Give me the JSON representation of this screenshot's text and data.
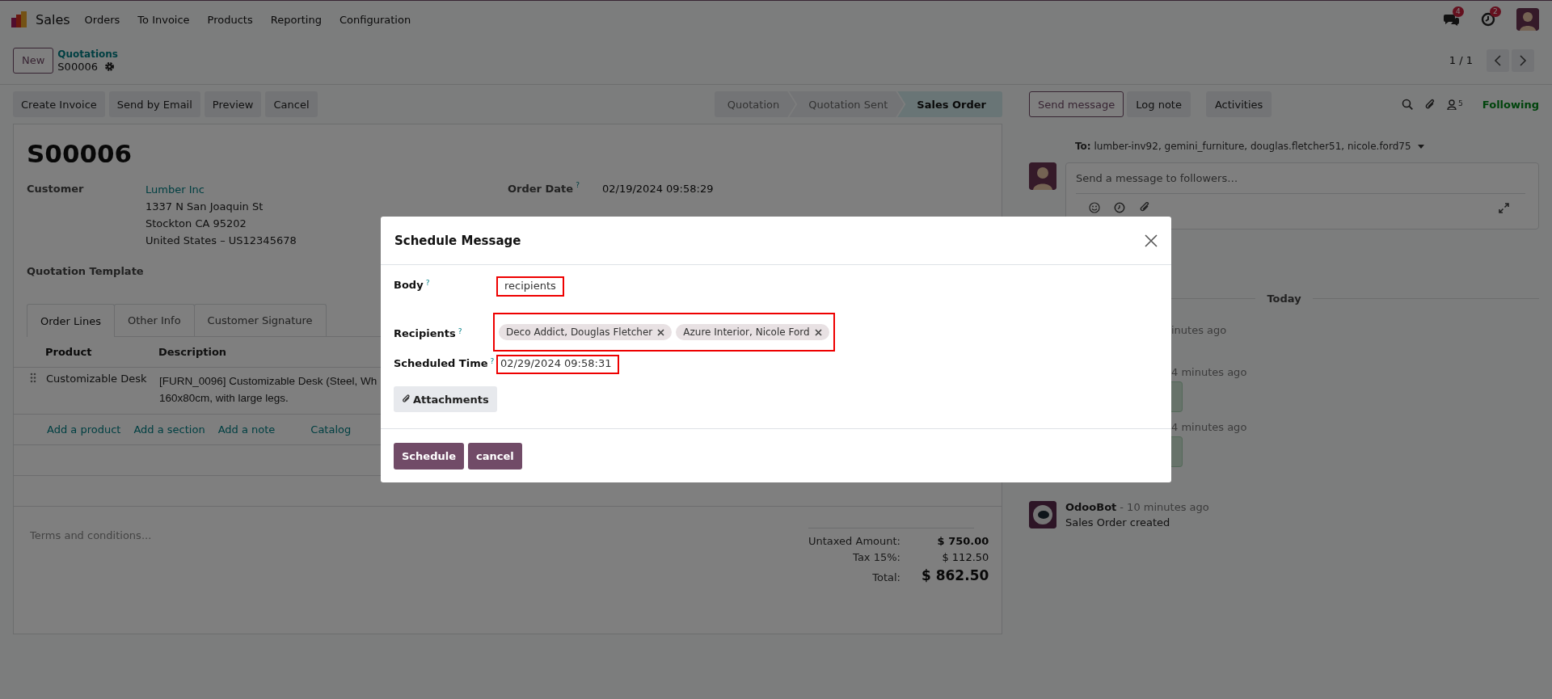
{
  "navbar": {
    "app": "Sales",
    "menu": [
      "Orders",
      "To Invoice",
      "Products",
      "Reporting",
      "Configuration"
    ],
    "messages_count": "4",
    "activities_count": "2"
  },
  "control_panel": {
    "new_button": "New",
    "breadcrumb_parent": "Quotations",
    "breadcrumb_current": "S00006",
    "pager": "1 / 1"
  },
  "actions": [
    "Create Invoice",
    "Send by Email",
    "Preview",
    "Cancel"
  ],
  "stages": [
    {
      "label": "Quotation",
      "selected": false
    },
    {
      "label": "Quotation Sent",
      "selected": false
    },
    {
      "label": "Sales Order",
      "selected": true
    }
  ],
  "form": {
    "title": "S00006",
    "customer": {
      "label": "Customer",
      "name": "Lumber Inc",
      "address": [
        "1337 N San Joaquin St",
        "Stockton CA 95202",
        "United States – US12345678"
      ]
    },
    "quotation_template": {
      "label": "Quotation Template"
    },
    "order_date": {
      "label": "Order Date",
      "help": "?",
      "value": "02/19/2024 09:58:29"
    },
    "tabs": [
      {
        "label": "Order Lines",
        "selected": true
      },
      {
        "label": "Other Info",
        "selected": false
      },
      {
        "label": "Customer Signature",
        "selected": false
      }
    ],
    "columns": [
      "Product",
      "Description"
    ],
    "rows": [
      {
        "product": "Customizable Desk",
        "description": [
          "[FURN_0096] Customizable Desk (Steel, Wh",
          "160x80cm, with large legs."
        ]
      }
    ],
    "add_links": [
      "Add a product",
      "Add a section",
      "Add a note",
      "Catalog"
    ],
    "terms_placeholder": "Terms and conditions...",
    "totals": [
      {
        "label": "Untaxed Amount:",
        "value": "$ 750.00",
        "kind": "bold"
      },
      {
        "label": "Tax 15%:",
        "value": "$ 112.50",
        "kind": "normal"
      },
      {
        "label": "Total:",
        "value": "$ 862.50",
        "kind": "grand"
      }
    ]
  },
  "chatter": {
    "buttons": [
      {
        "label": "Send message",
        "selected": true
      },
      {
        "label": "Log note",
        "selected": false
      },
      {
        "label": "Activities",
        "selected": false
      }
    ],
    "followers_count": "5",
    "follow_status": "Following",
    "to_label": "To:",
    "to": "lumber-inv92, gemini_furniture, douglas.fletcher51, nicole.ford75",
    "placeholder": "Send a message to followers…",
    "date_separator": "Today",
    "messages": [
      {
        "kind": "plain",
        "meta": "inutes ago"
      },
      {
        "kind": "bubble",
        "meta": "4 minutes ago"
      },
      {
        "kind": "bubble",
        "meta": "4 minutes ago"
      },
      {
        "kind": "full",
        "author": "OdooBot",
        "meta": "- 10 minutes ago",
        "body": "Sales Order created"
      }
    ]
  },
  "dialog": {
    "title": "Schedule Message",
    "fields": [
      {
        "kind": "text",
        "label": "Body",
        "help": "?",
        "value": "recipients",
        "highlighted": true
      },
      {
        "kind": "tags",
        "label": "Recipients",
        "help": "?",
        "tags": [
          "Deco Addict, Douglas Fletcher",
          "Azure Interior, Nicole Ford"
        ],
        "highlighted": true
      },
      {
        "kind": "text",
        "label": "Scheduled Time",
        "help": "?",
        "value": "02/29/2024 09:58:31",
        "highlighted": true
      }
    ],
    "attachments": "Attachments",
    "buttons": [
      "Schedule",
      "cancel"
    ]
  }
}
